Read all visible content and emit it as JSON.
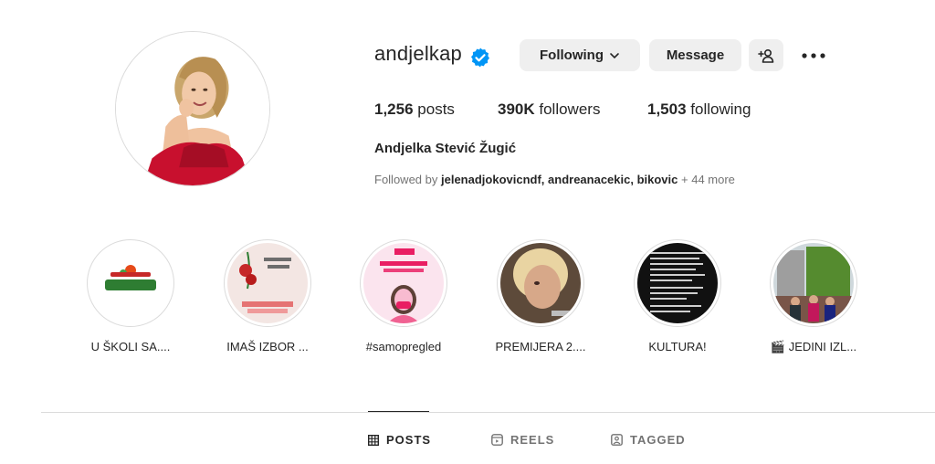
{
  "profile": {
    "username": "andjelkap",
    "full_name": "Andjelka Stević Žugić",
    "verified_icon": "verified-badge-icon"
  },
  "actions": {
    "following_label": "Following",
    "message_label": "Message",
    "add_user_icon": "add-user-icon",
    "more_icon": "more-options-icon"
  },
  "stats": {
    "posts_count": "1,256",
    "posts_label": "posts",
    "followers_count": "390K",
    "followers_label": "followers",
    "following_count": "1,503",
    "following_label": "following"
  },
  "followed_by": {
    "prefix": "Followed by",
    "names": "jelenadjokovicndf, andreanacekic, bikovic",
    "suffix": "+ 44 more"
  },
  "highlights": [
    {
      "label": "U ŠKOLI SA...."
    },
    {
      "label": "IMAŠ IZBOR ..."
    },
    {
      "label": "#samopregled"
    },
    {
      "label": "PREMIJERA 2...."
    },
    {
      "label": "KULTURA!"
    },
    {
      "label": "🎬 JEDINI IZL..."
    }
  ],
  "tabs": {
    "posts": "POSTS",
    "reels": "REELS",
    "tagged": "TAGGED"
  },
  "colors": {
    "verified_blue": "#0095f6",
    "button_bg": "#efefef",
    "text_primary": "#262626",
    "text_secondary": "#737373"
  }
}
